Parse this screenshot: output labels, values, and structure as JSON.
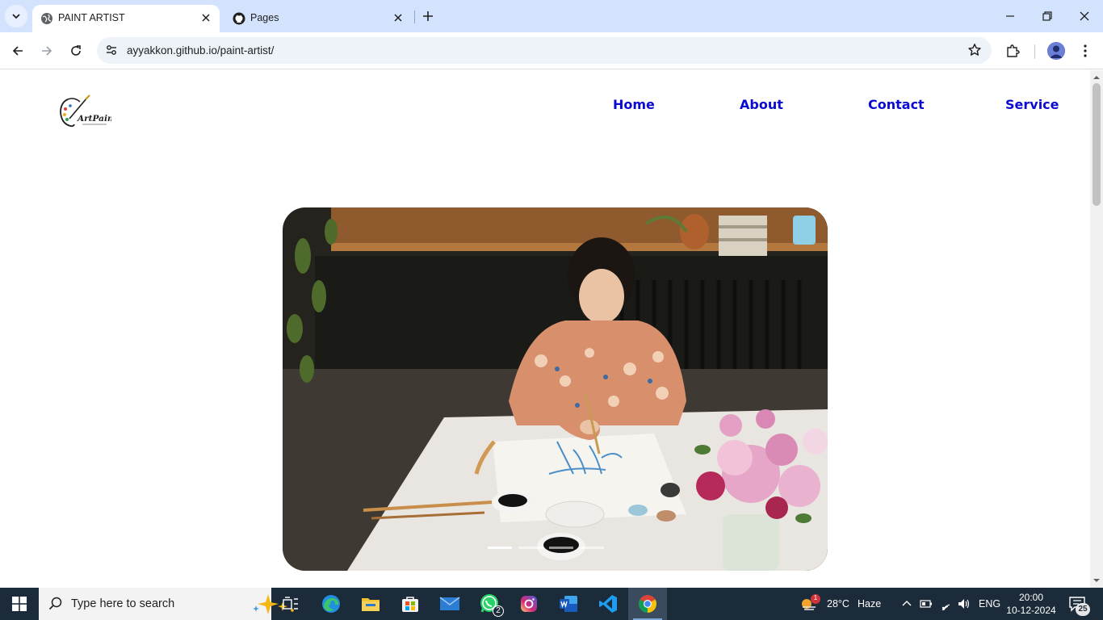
{
  "browser": {
    "tabs": [
      {
        "title": "PAINT ARTIST",
        "active": true,
        "icon": "globe-icon"
      },
      {
        "title": "Pages",
        "active": false,
        "icon": "github-icon"
      }
    ],
    "url": "ayyakkon.github.io/paint-artist/"
  },
  "site": {
    "logo_text": "ArtPaint",
    "nav": [
      "Home",
      "About",
      "Contact",
      "Service"
    ],
    "nav_color": "#0a0ad0",
    "hero": {
      "subject": "woman painting blue flowers with ink at a white table beside pink peonies",
      "slide_count": 4,
      "active_slide": 1
    }
  },
  "taskbar": {
    "search_placeholder": "Type here to search",
    "apps": [
      {
        "name": "task-view",
        "icon": "task-view-icon"
      },
      {
        "name": "edge",
        "icon": "edge-icon"
      },
      {
        "name": "file-explorer",
        "icon": "folder-icon"
      },
      {
        "name": "store",
        "icon": "store-icon"
      },
      {
        "name": "mail",
        "icon": "mail-icon"
      },
      {
        "name": "whatsapp",
        "icon": "whatsapp-icon",
        "badge": "2"
      },
      {
        "name": "instagram",
        "icon": "instagram-icon"
      },
      {
        "name": "word",
        "icon": "word-icon"
      },
      {
        "name": "vscode",
        "icon": "vscode-icon"
      },
      {
        "name": "chrome",
        "icon": "chrome-icon",
        "active": true
      }
    ],
    "weather": {
      "temp": "28°C",
      "condition": "Haze",
      "alert": "1"
    },
    "language": "ENG",
    "time": "20:00",
    "date": "10-12-2024",
    "notification_count": "25"
  }
}
